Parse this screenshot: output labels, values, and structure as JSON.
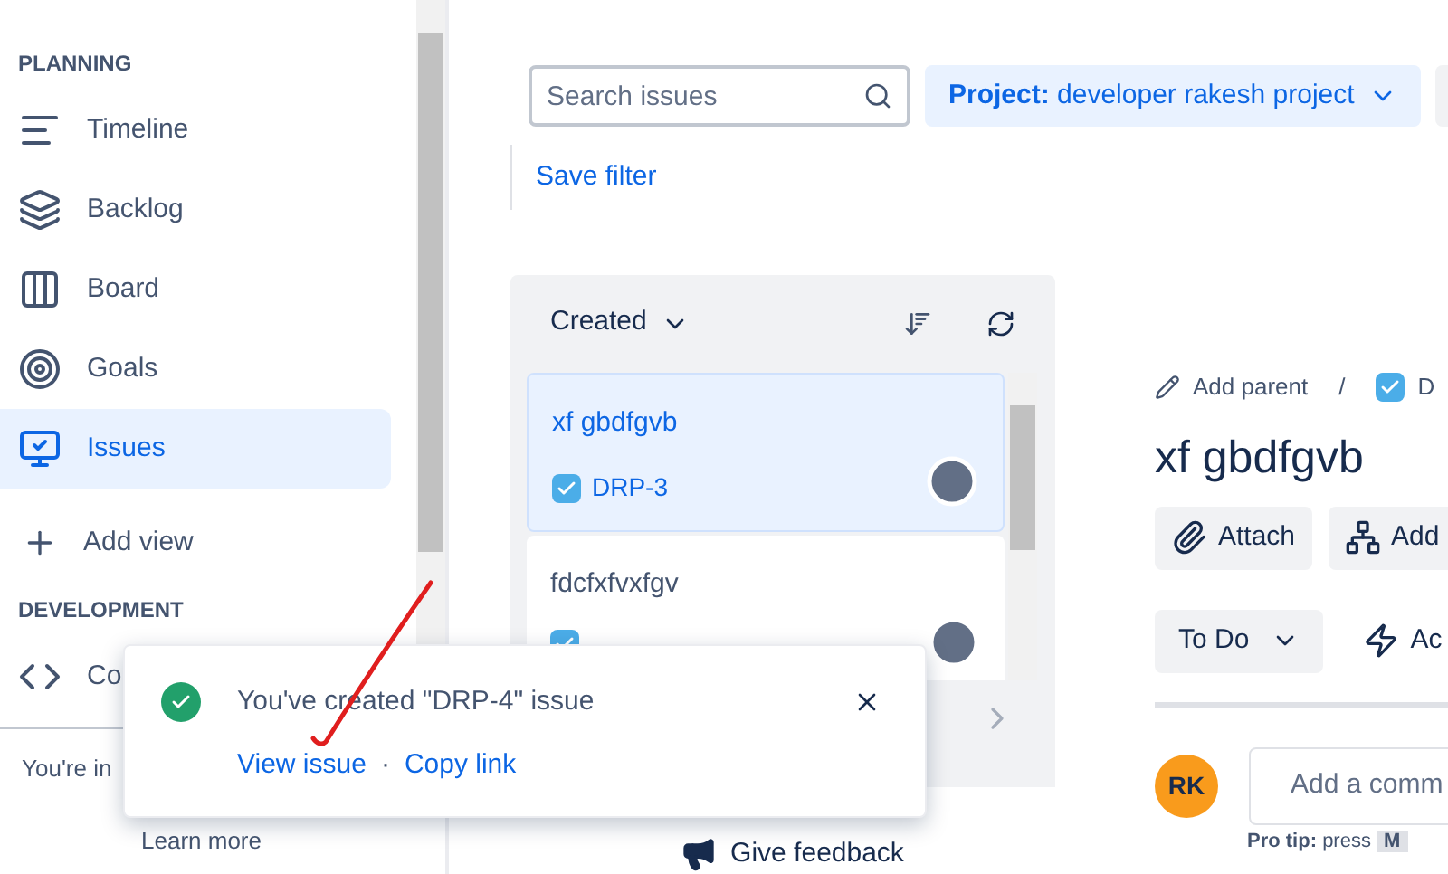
{
  "sidebar": {
    "sections": [
      {
        "heading": "PLANNING",
        "items": [
          {
            "label": "Timeline",
            "selected": false
          },
          {
            "label": "Backlog",
            "selected": false
          },
          {
            "label": "Board",
            "selected": false
          },
          {
            "label": "Goals",
            "selected": false
          },
          {
            "label": "Issues",
            "selected": true
          },
          {
            "label": "Add view",
            "selected": false
          }
        ]
      },
      {
        "heading": "DEVELOPMENT",
        "items": [
          {
            "label": "Co",
            "selected": false
          }
        ]
      }
    ],
    "footer_text": "You're in",
    "footer_link": "Learn more"
  },
  "search": {
    "placeholder": "Search issues"
  },
  "project_filter": {
    "label": "Project:",
    "value": "developer rakesh project"
  },
  "save_filter": "Save filter",
  "list": {
    "sort_label": "Created",
    "cards": [
      {
        "title": "xf gbdfgvb",
        "key": "DRP-3",
        "selected": true
      },
      {
        "title": "fdcfxfvxfgv",
        "selected": false
      }
    ]
  },
  "give_feedback": "Give feedback",
  "detail": {
    "add_parent": "Add parent",
    "separator": "/",
    "key_fragment": "D",
    "title": "xf gbdfgvb",
    "buttons": [
      {
        "label": "Attach"
      },
      {
        "label": "Add"
      }
    ],
    "status": "To Do",
    "actions": "Ac",
    "avatar": "RK",
    "comment_placeholder": "Add a comm",
    "pro_tip": "Pro tip:",
    "pro_tip_rest": "press",
    "pro_tip_key": "M"
  },
  "toast": {
    "message": "You've created \"DRP-4\" issue",
    "links": [
      "View issue",
      "Copy link"
    ],
    "separator": "·"
  }
}
